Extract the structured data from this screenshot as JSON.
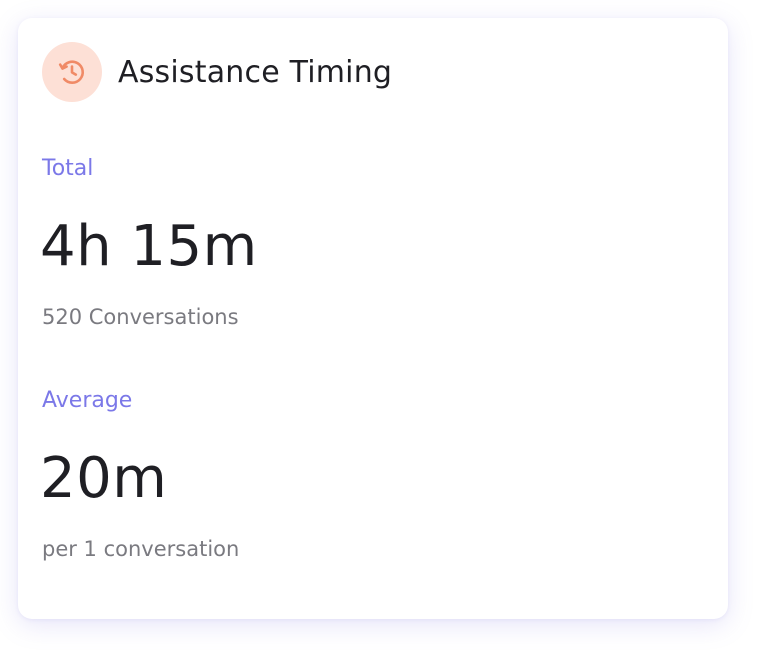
{
  "card": {
    "title": "Assistance Timing",
    "icon": "history-clock-icon",
    "icon_color": "#f08a66",
    "icon_bg": "#fde0d6",
    "label_color": "#7b78e8"
  },
  "total": {
    "label": "Total",
    "value": "4h 15m",
    "subtext": "520 Conversations"
  },
  "average": {
    "label": "Average",
    "value": "20m",
    "subtext": "per 1 conversation"
  }
}
